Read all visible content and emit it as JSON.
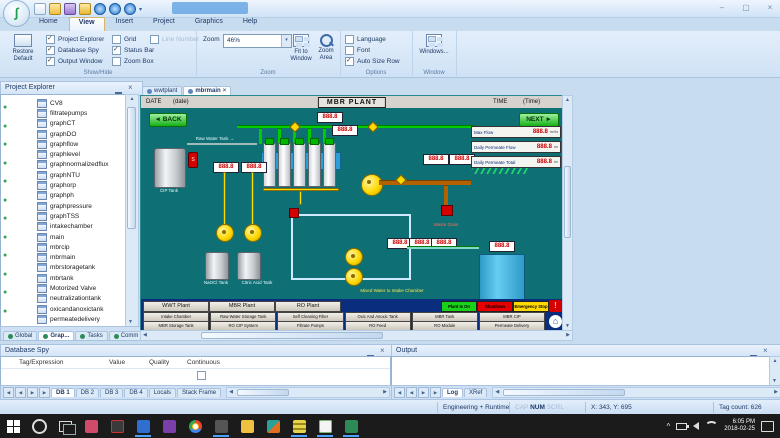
{
  "icons": {
    "app_logo": "∫",
    "dropdown": "▾",
    "window_minimize": "–",
    "window_maximize": "▢",
    "window_close": "×",
    "tab_close": "×",
    "scroll_up": "▲",
    "scroll_down": "▼",
    "scroll_left": "◀",
    "scroll_right": "▶",
    "back_arrow": "◄",
    "next_arrow": "►",
    "alarm": "!",
    "home": "⌂",
    "tray_chevron": "^"
  },
  "ribbon": {
    "tabs": [
      {
        "label": "Home"
      },
      {
        "label": "View",
        "active": true
      },
      {
        "label": "Insert"
      },
      {
        "label": "Project"
      },
      {
        "label": "Graphics"
      },
      {
        "label": "Help"
      }
    ],
    "show_hide": {
      "group_label": "Show/Hide",
      "restore_line1": "Restore",
      "restore_line2": "Default",
      "col1": [
        {
          "label": "Project Explorer",
          "checked": true
        },
        {
          "label": "Database Spy",
          "checked": true
        },
        {
          "label": "Output Window",
          "checked": true
        }
      ],
      "col2": [
        {
          "label": "Grid"
        },
        {
          "label": "Status Bar",
          "checked": true
        },
        {
          "label": "Zoom Box"
        }
      ],
      "col3": [
        {
          "label": "Line Number",
          "disabled": true
        }
      ]
    },
    "zoom": {
      "group_label": "Zoom",
      "combo_label": "Zoom",
      "combo_value": "46%",
      "fit_line1": "Fit to",
      "fit_line2": "Window",
      "area_line1": "Zoom",
      "area_line2": "Area"
    },
    "options": {
      "group_label": "Options",
      "items": [
        {
          "label": "Language"
        },
        {
          "label": "Font"
        },
        {
          "label": "Auto Size Row",
          "checked": true
        }
      ]
    },
    "window": {
      "group_label": "Window",
      "button_label": "Windows..."
    }
  },
  "explorer": {
    "title": "Project Explorer",
    "items": [
      "CV8",
      "filtratepumps",
      "graphCT",
      "graphDO",
      "graphflow",
      "graphlevel",
      "graphnormalizedflux",
      "graphNTU",
      "graphorp",
      "graphph",
      "graphpressure",
      "graphTSS",
      "intakechamber",
      "main",
      "mbrcip",
      "mbrmain",
      "mbrstoragetank",
      "mbrtank",
      "Motorized Valve",
      "neutralizationtank",
      "oxicandanoxictank",
      "permeatedelivery"
    ],
    "tabs": [
      {
        "label": "Global"
      },
      {
        "label": "Grap...",
        "active": true
      },
      {
        "label": "Tasks"
      },
      {
        "label": "Comm"
      }
    ]
  },
  "workspace": {
    "doc_tabs": [
      {
        "label": "wwtplant"
      },
      {
        "label": "mbrmain",
        "active": true
      }
    ]
  },
  "screen": {
    "date_label": "DATE",
    "date_value": "(date)",
    "title": "MBR PLANT",
    "time_label": "TIME",
    "time_value": "(Time)",
    "back": "BACK",
    "next": "NEXT",
    "display_value": "888.8",
    "stats": [
      {
        "label": "Max Flow",
        "value": "888.8",
        "unit": "m³/hr"
      },
      {
        "label": "Daily Permeate Flow",
        "value": "888.8",
        "unit": "m³"
      },
      {
        "label": "Daily Permeate Total",
        "value": "888.8",
        "unit": "m³"
      }
    ],
    "labels": {
      "feed": "Raw Water Tank →",
      "cip_tank": "CIP Tank",
      "mixer": "S",
      "tank1": "NaOCl Tank",
      "tank2": "Citric Acid Tank",
      "waste": "Waste Drain",
      "note": "Mixed Water to Intake Chamber"
    },
    "nav": {
      "row1": [
        {
          "label": "WWT Plant"
        },
        {
          "label": "MBR Plant"
        },
        {
          "label": "RO Plant"
        }
      ],
      "status": [
        {
          "label": "Plant Is On",
          "color": "green"
        },
        {
          "label": "Shutdown",
          "color": "red"
        },
        {
          "label": "Emergency Stop",
          "color": "yellow"
        }
      ],
      "row2": [
        {
          "label": "Intake Chamber"
        },
        {
          "label": "Raw Water Storage Tank"
        },
        {
          "label": "Self Cleaning Filter"
        },
        {
          "label": "Oxic And Anoxic Tank"
        },
        {
          "label": "MBR Tank"
        },
        {
          "label": "MBR CIP"
        }
      ],
      "row3": [
        {
          "label": "MBR Storage Tank"
        },
        {
          "label": "RO CIP System"
        },
        {
          "label": "Filtrate Pumps"
        },
        {
          "label": "RO Feed"
        },
        {
          "label": "RO Module"
        },
        {
          "label": "Permeate Delivery"
        }
      ]
    }
  },
  "database_spy": {
    "title": "Database Spy",
    "columns": [
      {
        "label": "Tag/Expression"
      },
      {
        "label": "Value"
      },
      {
        "label": "Quality"
      },
      {
        "label": "Continuous"
      }
    ],
    "tabs": [
      {
        "label": "DB 1",
        "active": true
      },
      {
        "label": "DB 2"
      },
      {
        "label": "DB 3"
      },
      {
        "label": "DB 4"
      },
      {
        "label": "Locals"
      },
      {
        "label": "Stack Frame"
      }
    ]
  },
  "output": {
    "title": "Output",
    "tabs": [
      {
        "label": "Log",
        "active": true
      },
      {
        "label": "XRef"
      }
    ]
  },
  "status_bar": {
    "mode": "Engineering + Runtime",
    "cap": "CAP",
    "num": "NUM",
    "scrl": "SCRL",
    "coords": "X: 343, Y: 695",
    "tag_count": "Tag count: 626"
  },
  "taskbar": {
    "time": "6:05 PM",
    "date": "2018-02-25"
  },
  "colors": {
    "canvas_teal": "#0e6f74",
    "pipe_green": "#00cc00",
    "pump_yellow": "#ffd900",
    "value_red": "#cc0000",
    "tank_blue": "#3fb6e8",
    "nav_navy": "#0a2d7e",
    "taskbar_accent": "#4aa3ff"
  }
}
